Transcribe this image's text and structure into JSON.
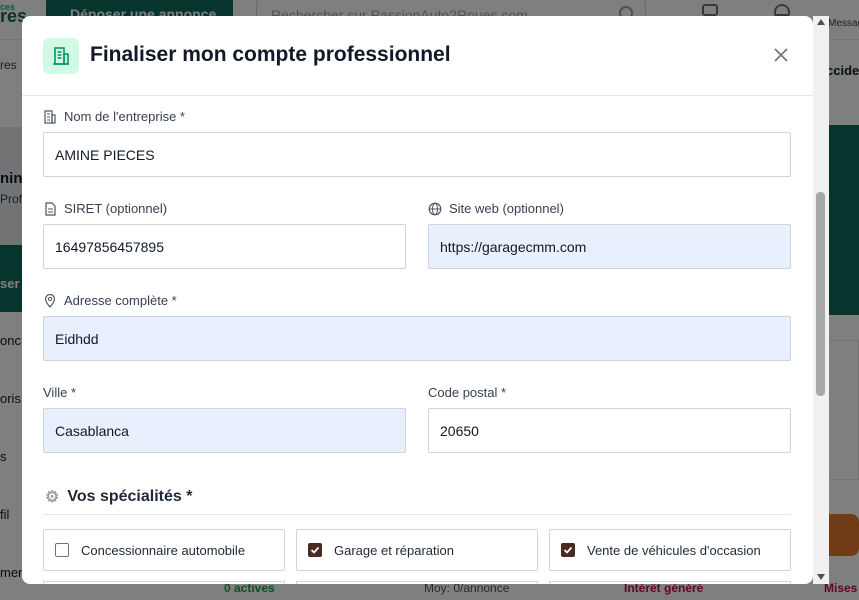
{
  "background": {
    "logo_small": "ces",
    "logo": "res",
    "deposit_button": "Déposer une annonce",
    "search_placeholder": "Rechercher sur PassionAuto2Roues.com",
    "messages_label": "Messag",
    "nav_left": "res",
    "nav_right": "ccide",
    "hero_title": "nin",
    "hero_subtitle": "Prof",
    "hero_button": "ser",
    "side_items": [
      "onc",
      "oris",
      "s",
      "fil",
      "men"
    ],
    "bottom_stats": [
      "0 actives",
      "Moy: 0/annonce",
      "Intérêt généré",
      "Mises"
    ]
  },
  "modal": {
    "title": "Finaliser mon compte professionnel",
    "header_icon": "building-icon",
    "fields": {
      "company": {
        "label": "Nom de l'entreprise *",
        "value": "AMINE PIECES",
        "icon": "building-icon"
      },
      "siret": {
        "label": "SIRET (optionnel)",
        "value": "16497856457895",
        "icon": "document-icon"
      },
      "website": {
        "label": "Site web (optionnel)",
        "value": "https://garagecmm.com",
        "icon": "globe-icon"
      },
      "address": {
        "label": "Adresse complète *",
        "value": "Eidhdd",
        "icon": "map-pin-icon"
      },
      "city": {
        "label": "Ville *",
        "value": "Casablanca"
      },
      "postal_code": {
        "label": "Code postal *",
        "value": "20650"
      }
    },
    "specialties": {
      "title": "Vos spécialités *",
      "items": [
        {
          "label": "Concessionnaire automobile",
          "checked": false
        },
        {
          "label": "Garage et réparation",
          "checked": true
        },
        {
          "label": "Vente de véhicules d'occasion",
          "checked": true
        }
      ]
    }
  },
  "colors": {
    "brand": "#0f6b5c",
    "autofill": "#e8f0fe",
    "checkbox": "#4a2b22"
  }
}
